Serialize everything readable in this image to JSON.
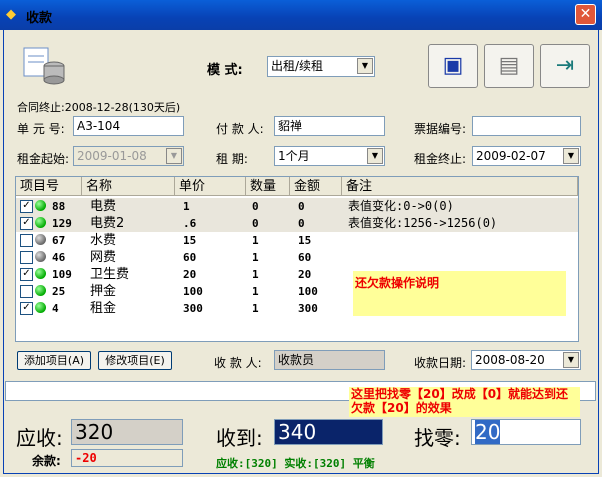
{
  "window": {
    "title": "收款",
    "close_glyph": "✕"
  },
  "mode": {
    "label": "模  式:",
    "value": "出租/续租"
  },
  "contract_end_note": "合同终止:2008-12-28(130天后)",
  "fields": {
    "unit_label": "单 元 号:",
    "unit_value": "A3-104",
    "payer_label": "付 款 人:",
    "payer_value": "貂禅",
    "ticket_label": "票据编号:",
    "ticket_value": "",
    "rent_start_label": "租金起始:",
    "rent_start_value": "2009-01-08",
    "period_label": "租   期:",
    "period_value": "1个月",
    "rent_end_label": "租金终止:",
    "rent_end_value": "2009-02-07"
  },
  "table": {
    "headers": [
      "项目号",
      "名称",
      "单价",
      "数量",
      "金额",
      "备注"
    ],
    "rows": [
      {
        "checked": true,
        "status": "green",
        "id": "88",
        "name": "电费",
        "price": "1",
        "qty": "0",
        "amount": "0",
        "note": "表值变化:0->0(0)"
      },
      {
        "checked": true,
        "status": "green",
        "id": "129",
        "name": "电费2",
        "price": ".6",
        "qty": "0",
        "amount": "0",
        "note": "表值变化:1256->1256(0)"
      },
      {
        "checked": false,
        "status": "gray",
        "id": "67",
        "name": "水费",
        "price": "15",
        "qty": "1",
        "amount": "15",
        "note": ""
      },
      {
        "checked": false,
        "status": "gray",
        "id": "46",
        "name": "网费",
        "price": "60",
        "qty": "1",
        "amount": "60",
        "note": ""
      },
      {
        "checked": true,
        "status": "green",
        "id": "109",
        "name": "卫生费",
        "price": "20",
        "qty": "1",
        "amount": "20",
        "note": ""
      },
      {
        "checked": false,
        "status": "green",
        "id": "25",
        "name": "押金",
        "price": "100",
        "qty": "1",
        "amount": "100",
        "note": ""
      },
      {
        "checked": true,
        "status": "green",
        "id": "4",
        "name": "租金",
        "price": "300",
        "qty": "1",
        "amount": "300",
        "note": ""
      }
    ],
    "debt_note": "还欠款操作说明"
  },
  "buttons": {
    "add_item": "添加项目(A)",
    "edit_item": "修改项目(E)"
  },
  "collector": {
    "label": "收 款 人:",
    "value": "收款员"
  },
  "collect_date": {
    "label": "收款日期:",
    "value": "2008-08-20"
  },
  "tip": "这里把找零【20】改成【0】就能达到还欠款【20】的效果",
  "summary": {
    "receivable_label": "应收:",
    "receivable_value": "320",
    "received_label": "收到:",
    "received_value": "340",
    "change_label": "找零:",
    "change_value": "20",
    "balance_label": "余款:",
    "balance_value": "-20",
    "status_line": "应收:[320] 实收:[320] 平衡"
  }
}
